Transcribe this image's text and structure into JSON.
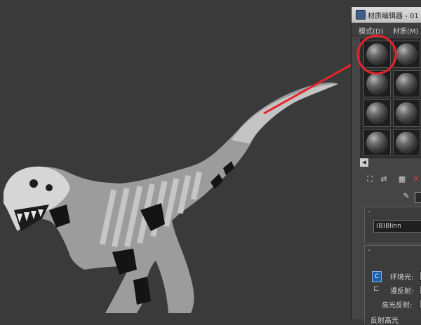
{
  "window": {
    "title": "材质编辑器 - 01"
  },
  "menu": {
    "items": [
      "模式(D)",
      "材质(M)"
    ]
  },
  "shader": {
    "selected": "(B)Blinn"
  },
  "params": {
    "ambient": "环境光:",
    "diffuse": "漫反射:",
    "specular": "高光反射:",
    "next_rollout": "反射高光"
  },
  "icons": {
    "app": "app-icon",
    "lock": "lock-icon"
  },
  "colors": {
    "annotation": "#e8232b",
    "viewport_bg": "#3a3a3a",
    "skeleton_light": "#b8b8b8",
    "skeleton_dark": "#141414"
  }
}
